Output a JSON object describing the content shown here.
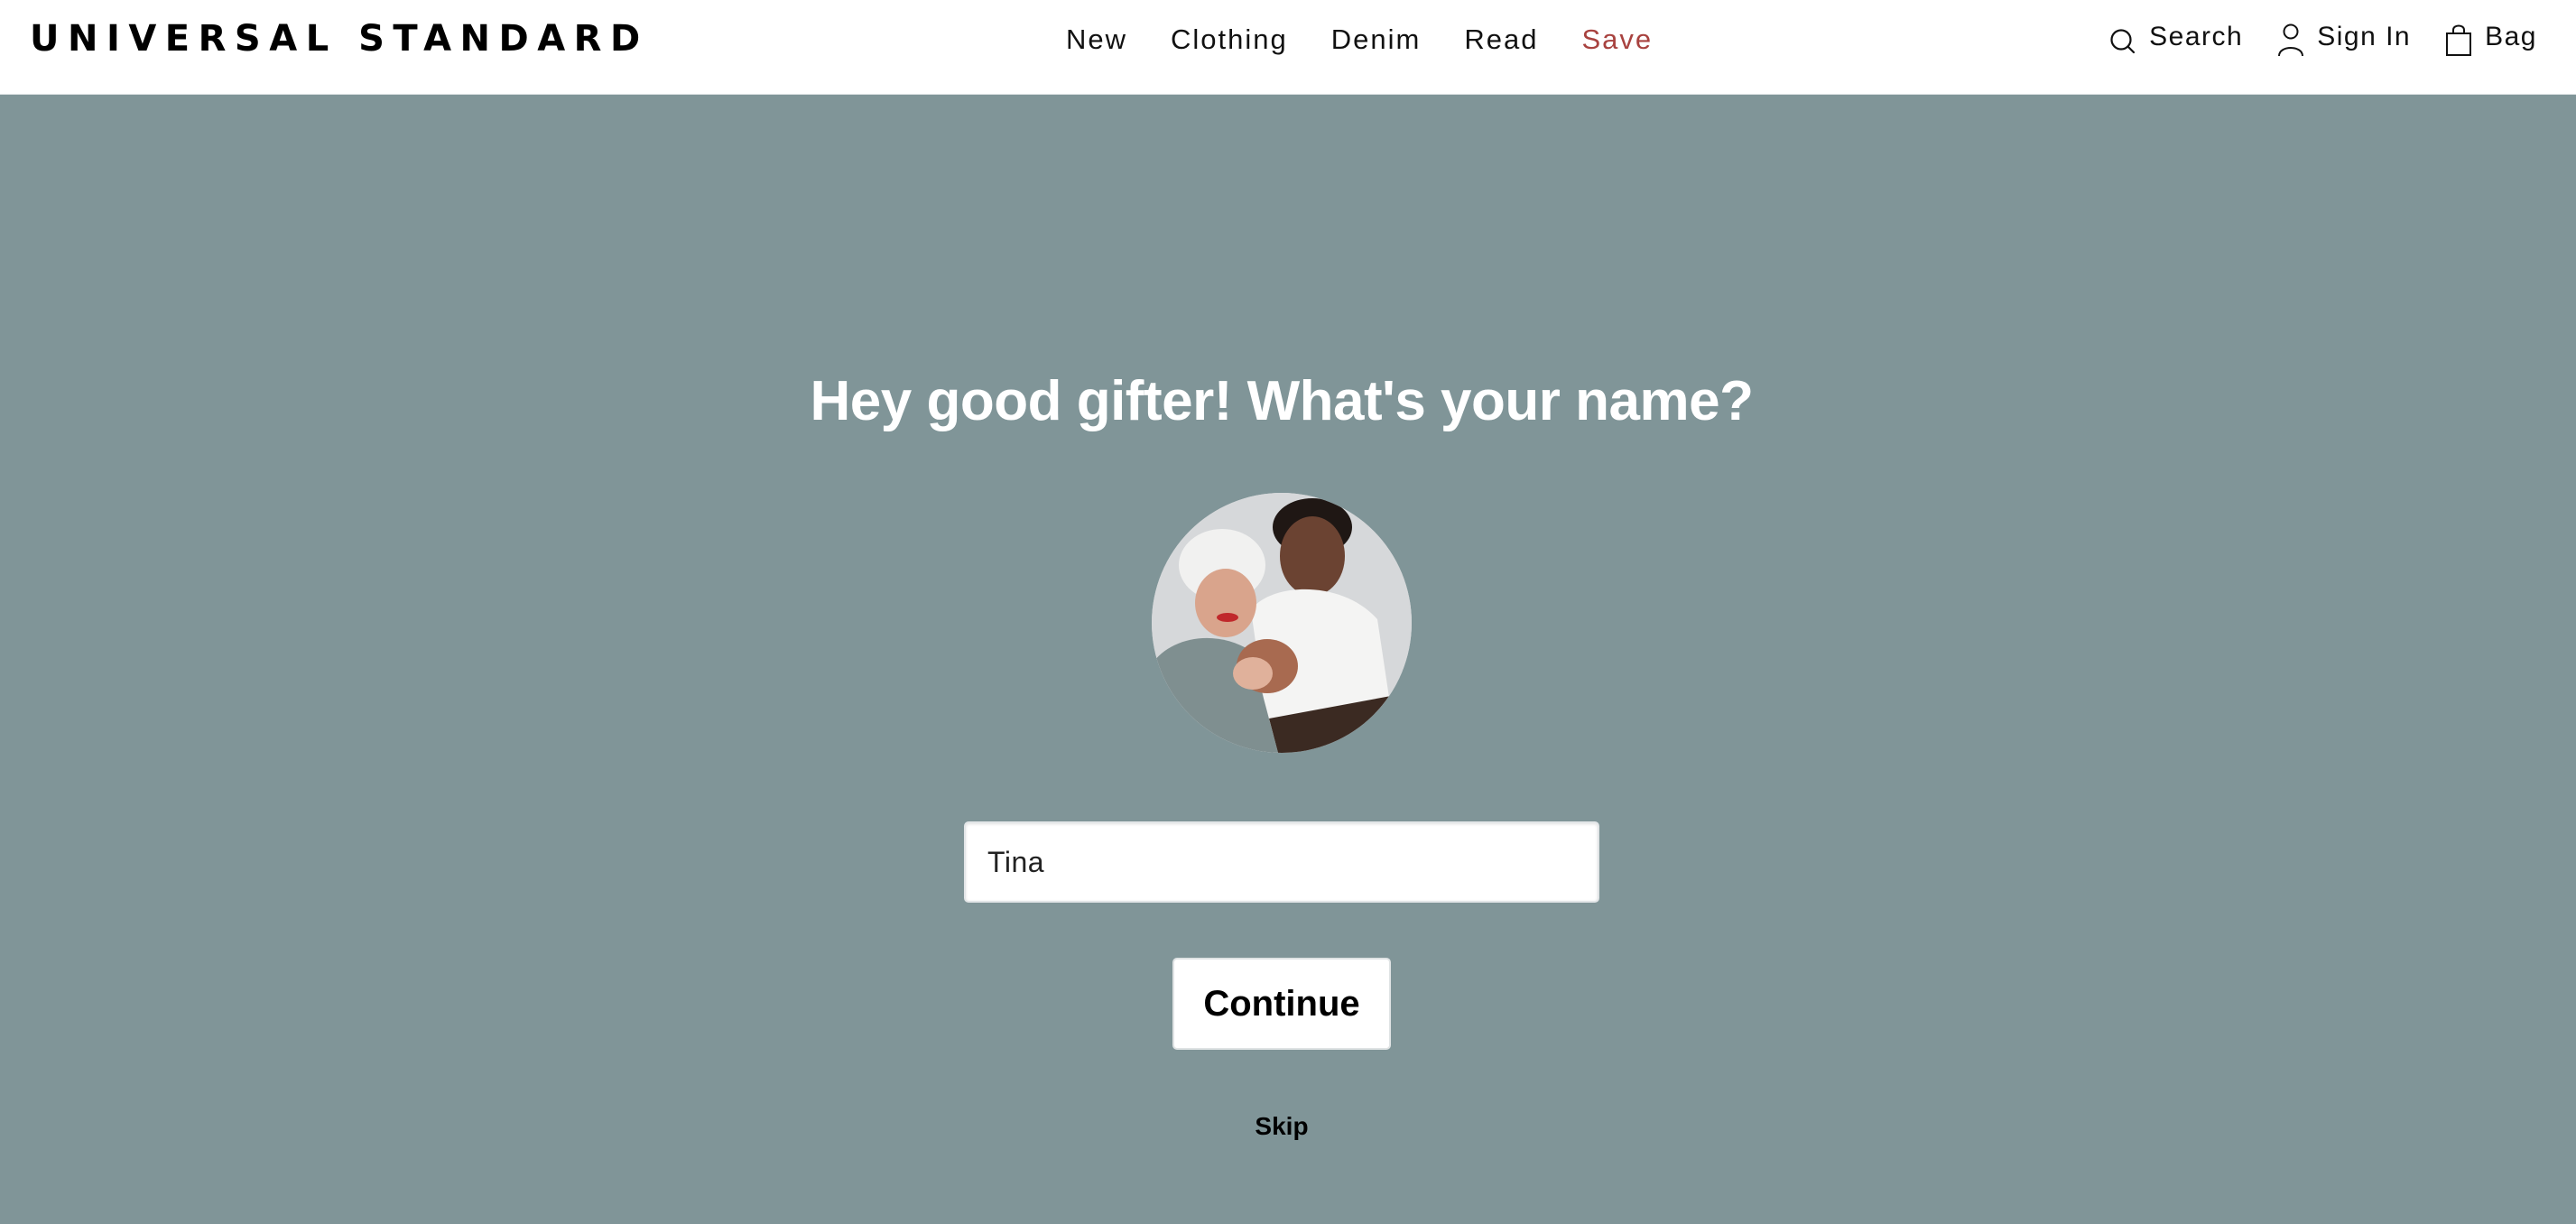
{
  "header": {
    "logo": "UNIVERSAL STANDARD",
    "nav": [
      {
        "label": "New"
      },
      {
        "label": "Clothing"
      },
      {
        "label": "Denim"
      },
      {
        "label": "Read"
      },
      {
        "label": "Save",
        "highlight": true
      }
    ],
    "utilities": {
      "search": {
        "label": "Search",
        "icon": "search-icon"
      },
      "signin": {
        "label": "Sign In",
        "icon": "user-icon"
      },
      "bag": {
        "label": "Bag",
        "icon": "shopping-bag-icon"
      }
    }
  },
  "main": {
    "title": "Hey good gifter! What's your name?",
    "image_alt": "Two smiling women dancing together holding hands",
    "name_input": {
      "value": "Tina",
      "placeholder": ""
    },
    "continue_label": "Continue",
    "skip_label": "Skip"
  },
  "colors": {
    "background": "#809598",
    "header_bg": "#ffffff",
    "sale_link": "#a8423f",
    "title_text": "#ffffff"
  }
}
